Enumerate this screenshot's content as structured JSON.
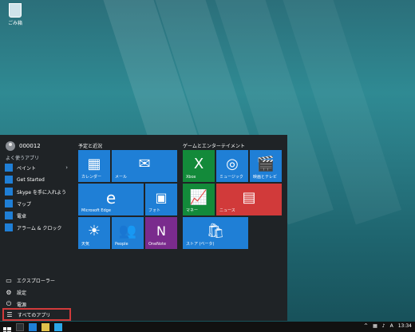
{
  "desktop": {
    "recycle_bin_label": "ごみ箱"
  },
  "start": {
    "user": {
      "name": "000012"
    },
    "frequent_title": "よく使うアプリ",
    "frequent": [
      {
        "label": "ペイント",
        "has_chevron": true
      },
      {
        "label": "Get Started",
        "has_chevron": false
      },
      {
        "label": "Skype を手に入れよう",
        "has_chevron": false
      },
      {
        "label": "マップ",
        "has_chevron": false
      },
      {
        "label": "電卓",
        "has_chevron": false
      },
      {
        "label": "アラーム & クロック",
        "has_chevron": false
      }
    ],
    "bottom": [
      {
        "label": "エクスプローラー"
      },
      {
        "label": "設定"
      },
      {
        "label": "電源"
      }
    ],
    "all_apps_label": "すべてのアプリ",
    "groups": {
      "left_title": "予定と近況",
      "right_title": "ゲームとエンターテイメント"
    },
    "tiles": [
      {
        "id": "calendar",
        "label": "カレンダー",
        "color": "#1f7fd6"
      },
      {
        "id": "mail",
        "label": "メール",
        "color": "#1f7fd6"
      },
      {
        "id": "edge",
        "label": "Microsoft Edge",
        "color": "#1f7fd6"
      },
      {
        "id": "photos",
        "label": "フォト",
        "color": "#1f7fd6"
      },
      {
        "id": "weather",
        "label": "天気",
        "color": "#1f7fd6"
      },
      {
        "id": "people",
        "label": "People",
        "color": "#1f7fd6"
      },
      {
        "id": "onenote",
        "label": "OneNote",
        "color": "#7a2b8d"
      },
      {
        "id": "xbox",
        "label": "Xbox",
        "color": "#138a3a"
      },
      {
        "id": "music",
        "label": "ミュージック",
        "color": "#1f7fd6"
      },
      {
        "id": "movies",
        "label": "映画とテレビ",
        "color": "#1f7fd6"
      },
      {
        "id": "money",
        "label": "マネー",
        "color": "#138a3a"
      },
      {
        "id": "news",
        "label": "ニュース",
        "color": "#d13a3a"
      },
      {
        "id": "store",
        "label": "ストア (ベータ)",
        "color": "#1f7fd6"
      }
    ]
  },
  "taskbar": {
    "clock": "13:34"
  }
}
